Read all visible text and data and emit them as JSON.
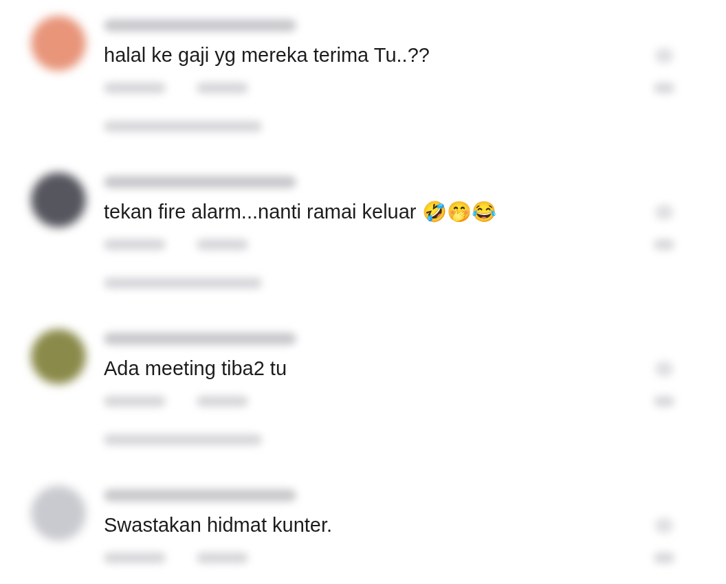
{
  "comments": [
    {
      "text": "halal ke gaji yg mereka terima Tu..??",
      "color": "#e8957a",
      "replies": true
    },
    {
      "text": "tekan fire alarm...nanti ramai keluar 🤣🤭😂",
      "color": "#55565e",
      "replies": true
    },
    {
      "text": "Ada meeting tiba2 tu",
      "color": "#8a8a4a",
      "replies": true
    },
    {
      "text": "Swastakan hidmat kunter.",
      "color": "#c9cacf",
      "replies": false
    }
  ]
}
